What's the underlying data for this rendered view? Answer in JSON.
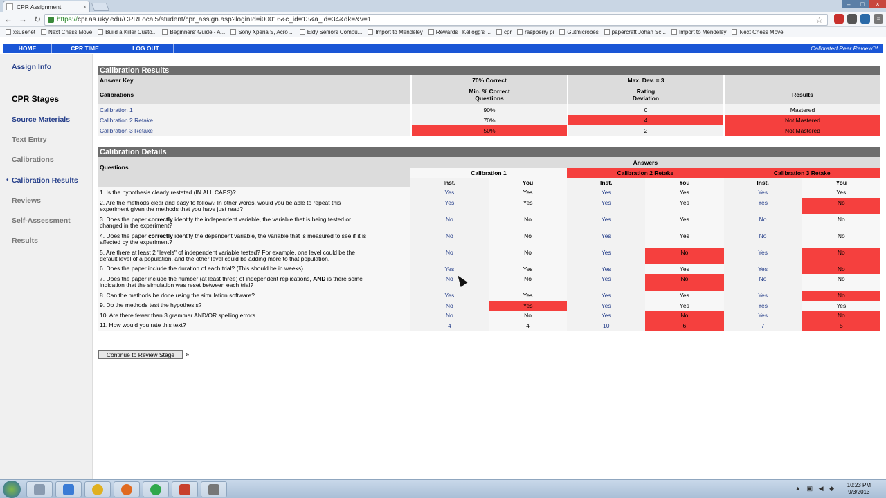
{
  "browser": {
    "tab_title": "CPR Assignment",
    "tab_close": "×",
    "url_scheme": "https://",
    "url_rest": "cpr.as.uky.edu/CPRLocal5/student/cpr_assign.asp?loginId=i00016&c_id=13&a_id=34&dk=&v=1",
    "bookmarks": [
      "xsusenet",
      "Next Chess Move",
      "Build a Killer Custo...",
      "Beginners' Guide - A...",
      "Sony Xperia S, Acro ...",
      "Eldy Seniors Compu...",
      "Import to Mendeley",
      "Rewards | Kellogg's ...",
      "cpr",
      "raspberry pi",
      "Gutmicrobes",
      "papercraft Johan Sc...",
      "Import to Mendeley",
      "Next Chess Move"
    ]
  },
  "topnav": {
    "home": "HOME",
    "cpr_time": "CPR TIME",
    "logout": "LOG OUT",
    "brand": "Calibrated Peer Review™"
  },
  "sidebar": {
    "assign_info": "Assign Info",
    "stages_heading": "CPR Stages",
    "items": [
      "Source Materials",
      "Text Entry",
      "Calibrations",
      "Calibration Results",
      "Reviews",
      "Self-Assessment",
      "Results"
    ]
  },
  "results": {
    "title": "Calibration Results",
    "answer_key": "Answer Key",
    "pct_correct": "70% Correct",
    "max_dev": "Max. Dev. = 3",
    "col_calibrations": "Calibrations",
    "col_min_pct": "Min. % Correct",
    "col_min_pct2": "Questions",
    "col_rating": "Rating",
    "col_rating2": "Deviation",
    "col_results": "Results",
    "rows": [
      {
        "name": "Calibration 1",
        "pct": "90%",
        "dev": "0",
        "result": "Mastered"
      },
      {
        "name": "Calibration 2 Retake",
        "pct": "70%",
        "dev": "4",
        "result": "Not Mastered"
      },
      {
        "name": "Calibration 3 Retake",
        "pct": "50%",
        "dev": "2",
        "result": "Not Mastered"
      }
    ]
  },
  "details": {
    "title": "Calibration Details",
    "answers": "Answers",
    "questions": "Questions",
    "cal1": "Calibration 1",
    "cal2": "Calibration 2 Retake",
    "cal3": "Calibration 3 Retake",
    "inst": "Inst.",
    "you": "You",
    "q": [
      {
        "a": "1. Is the hypothesis clearly restated (IN ALL CAPS)?",
        "b": "",
        "c": "",
        "v": [
          "Yes",
          "Yes",
          "Yes",
          "Yes",
          "Yes",
          "Yes"
        ]
      },
      {
        "a": "2. Are the methods clear and easy to follow? In other words, would you be able to repeat this",
        "b": "experiment given the methods that you have just read?",
        "c": "",
        "v": [
          "Yes",
          "Yes",
          "Yes",
          "Yes",
          "Yes",
          "No"
        ]
      },
      {
        "a": "3. Does the paper ",
        "b": "correctly",
        "c": " identify the independent variable, the variable that is being tested or",
        "d": "changed in the experiment?",
        "v": [
          "No",
          "No",
          "Yes",
          "Yes",
          "No",
          "No"
        ]
      },
      {
        "a": "4. Does the paper ",
        "b": "correctly",
        "c": " identify the dependent variable, the variable that is measured to see if it is",
        "d": "affected by the experiment?",
        "v": [
          "No",
          "No",
          "Yes",
          "Yes",
          "No",
          "No"
        ]
      },
      {
        "a": "5. Are there at least 2 \"levels\" of independent variable tested? For example, one level could be the",
        "b": "default level of a population, and the other level could be adding more to that population.",
        "c": "",
        "v": [
          "No",
          "No",
          "Yes",
          "No",
          "Yes",
          "No"
        ]
      },
      {
        "a": "6. Does the paper include the duration of each trial? (This should be in weeks)",
        "b": "",
        "c": "",
        "v": [
          "Yes",
          "Yes",
          "Yes",
          "Yes",
          "Yes",
          "No"
        ]
      },
      {
        "a": "7. Does the paper include the number (at least three) of independent replications, ",
        "b": "AND",
        "c": " is there some",
        "d": "indication that the simulation was reset between each trial?",
        "v": [
          "No",
          "No",
          "Yes",
          "No",
          "No",
          "No"
        ]
      },
      {
        "a": "8. Can the methods be done using the simulation software?",
        "b": "",
        "c": "",
        "v": [
          "Yes",
          "Yes",
          "Yes",
          "Yes",
          "Yes",
          "No"
        ]
      },
      {
        "a": "9. Do the methods test the hypothesis?",
        "b": "",
        "c": "",
        "v": [
          "No",
          "Yes",
          "Yes",
          "Yes",
          "Yes",
          "Yes"
        ]
      },
      {
        "a": "10. Are there fewer than 3 grammar AND/OR spelling errors",
        "b": "",
        "c": "",
        "v": [
          "No",
          "No",
          "Yes",
          "No",
          "Yes",
          "No"
        ]
      },
      {
        "a": "11. How would you rate this text?",
        "b": "",
        "c": "",
        "v": [
          "4",
          "4",
          "10",
          "6",
          "7",
          "5"
        ]
      }
    ]
  },
  "continue_label": "Continue to Review Stage",
  "raquo": "»",
  "clock": {
    "time": "10:23 PM",
    "date": "9/3/2013"
  }
}
